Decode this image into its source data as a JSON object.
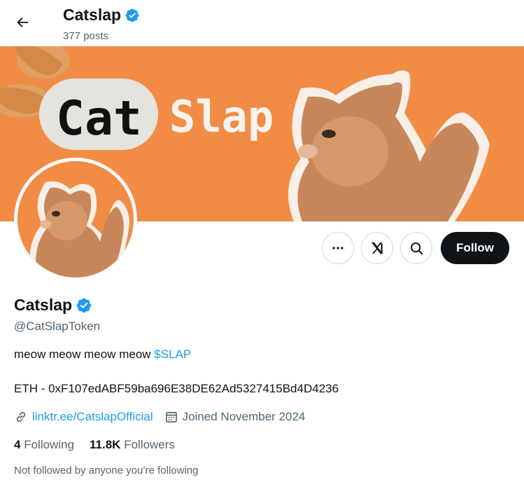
{
  "header": {
    "title": "Catslap",
    "posts_count": "377 posts"
  },
  "banner": {
    "text_left": "Cat",
    "text_right": "Slap",
    "background_color": "#f28c45"
  },
  "profile": {
    "name": "Catslap",
    "handle": "@CatSlapToken",
    "bio_text": "meow meow meow meow ",
    "bio_cashtag": "$SLAP",
    "eth_line": "ETH - 0xF107edABF59ba696E38DE62Ad5327415Bd4D4236",
    "link": "linktr.ee/CatslapOfficial",
    "joined": "Joined November 2024",
    "verified_color": "#1d9bf0"
  },
  "actions": {
    "follow_label": "Follow",
    "more_icon": "ellipsis-icon",
    "grok_icon": "grok-icon",
    "search_icon": "search-icon"
  },
  "stats": {
    "following_count": "4",
    "following_label": "Following",
    "followers_count": "11.8K",
    "followers_label": "Followers"
  },
  "note": "Not followed by anyone you’re following"
}
